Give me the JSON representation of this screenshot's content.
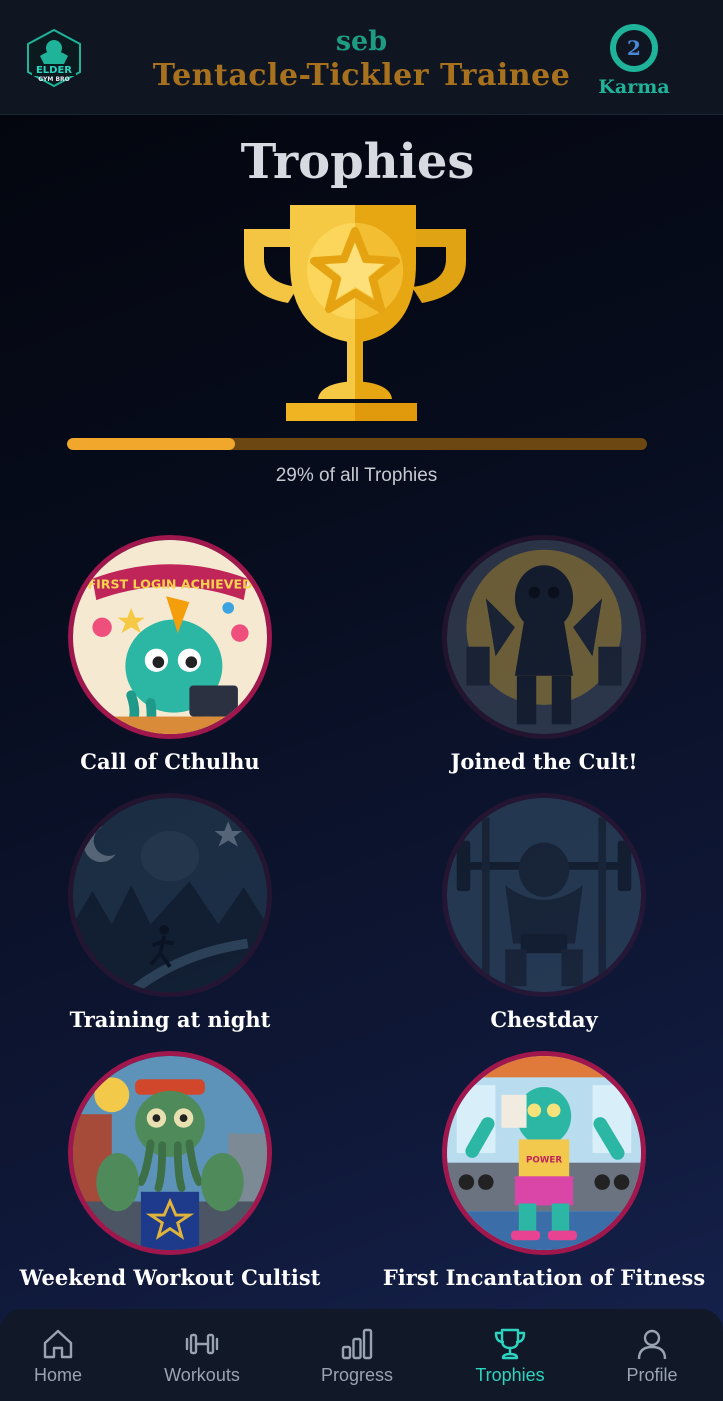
{
  "header": {
    "logo_text": "ELDER GYM BRO",
    "username": "seb",
    "rank_title": "Tentacle-Tickler Trainee",
    "karma_value": "2",
    "karma_label": "Karma"
  },
  "page": {
    "title": "Trophies",
    "progress_fraction": 0.29,
    "progress_text": "29% of all Trophies"
  },
  "trophies": [
    {
      "name": "Call of Cthulhu",
      "unlocked": true,
      "badge_text": "FIRST LOGIN ACHIEVED"
    },
    {
      "name": "Joined the Cult!",
      "unlocked": false
    },
    {
      "name": "Training at night",
      "unlocked": false
    },
    {
      "name": "Chestday",
      "unlocked": false
    },
    {
      "name": "Weekend Workout Cultist",
      "unlocked": true
    },
    {
      "name": "First Incantation of Fitness",
      "unlocked": true
    }
  ],
  "nav": {
    "items": [
      {
        "label": "Home",
        "icon": "home-icon"
      },
      {
        "label": "Workouts",
        "icon": "dumbbell-icon"
      },
      {
        "label": "Progress",
        "icon": "bar-chart-icon"
      },
      {
        "label": "Trophies",
        "icon": "trophy-icon",
        "active": true
      },
      {
        "label": "Profile",
        "icon": "user-icon"
      }
    ]
  },
  "colors": {
    "accent_teal": "#2dd4bf",
    "gold": "#f0a72b",
    "badge_border": "#a0174d"
  }
}
